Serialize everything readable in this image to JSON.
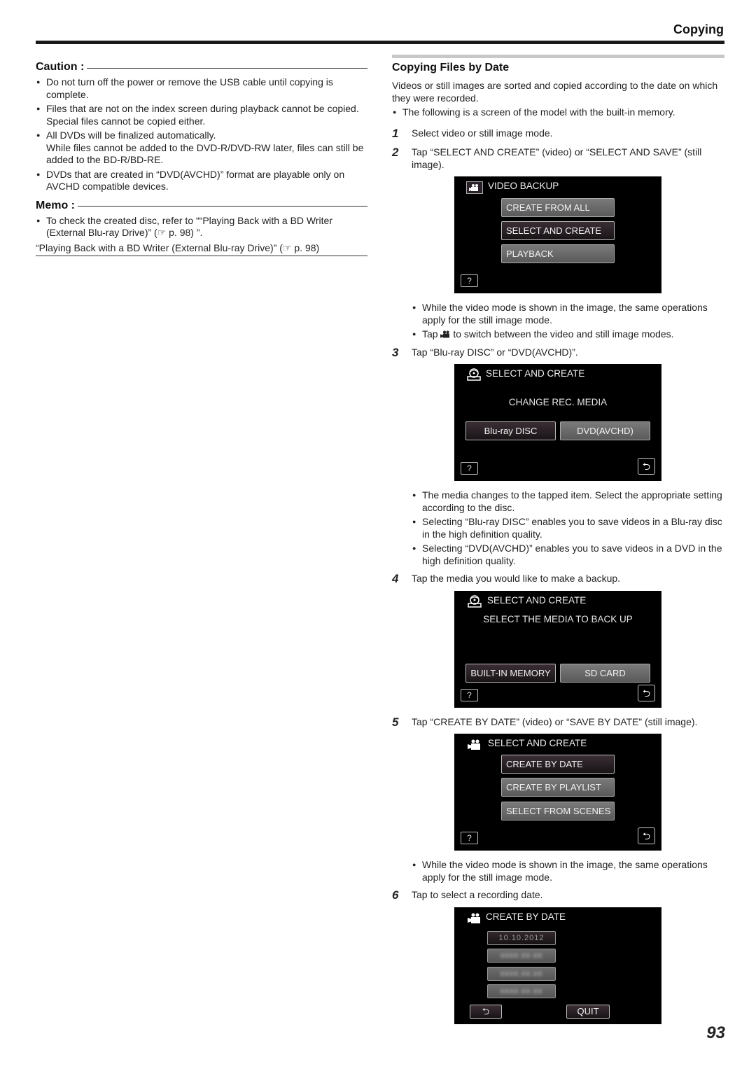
{
  "header": {
    "title": "Copying"
  },
  "caution": {
    "heading": "Caution :",
    "items": [
      "Do not turn off the power or remove the USB cable until copying is complete.",
      "Files that are not on the index screen during playback cannot be copied. Special files cannot be copied either.",
      "All DVDs will be finalized automatically.",
      "DVDs that are created in “DVD(AVCHD)” format are playable only on AVCHD compatible devices."
    ],
    "item3_extra": "While files cannot be added to the DVD-R/DVD-RW later, files can still be added to the BD-R/BD-RE."
  },
  "memo": {
    "heading": "Memo :",
    "items": [
      "To check the created disc, refer to ““Playing Back with a BD Writer (External Blu-ray Drive)” (☞ p. 98) ”."
    ],
    "link": "“Playing Back with a BD Writer (External Blu-ray Drive)” (☞ p. 98)"
  },
  "main": {
    "title": "Copying Files by Date",
    "intro": "Videos or still images are sorted and copied according to the date on which they were recorded.",
    "intro_bullet": "The following is a screen of the model with the built-in memory.",
    "steps": [
      {
        "num": "1",
        "text": "Select video or still image mode."
      },
      {
        "num": "2",
        "text": "Tap “SELECT AND CREATE” (video) or “SELECT AND SAVE” (still image).",
        "notes": [
          "While the video mode is shown in the image, the same operations apply for the still image mode.",
          "to switch between the video and still image modes."
        ],
        "note_tap": "Tap"
      },
      {
        "num": "3",
        "text": "Tap “Blu-ray DISC” or “DVD(AVCHD)”.",
        "notes": [
          "The media changes to the tapped item. Select the appropriate setting according to the disc.",
          "Selecting “Blu-ray DISC” enables you to save videos in a Blu-ray disc in the high definition quality.",
          "Selecting “DVD(AVCHD)” enables you to save videos in a DVD in the high definition quality."
        ]
      },
      {
        "num": "4",
        "text": "Tap the media you would like to make a backup."
      },
      {
        "num": "5",
        "text": "Tap “CREATE BY DATE” (video) or “SAVE BY DATE” (still image).",
        "notes": [
          "While the video mode is shown in the image, the same operations apply for the still image mode."
        ]
      },
      {
        "num": "6",
        "text": "Tap to select a recording date."
      }
    ]
  },
  "screens": {
    "video_backup": {
      "title": "VIDEO BACKUP",
      "buttons": [
        "CREATE FROM ALL",
        "SELECT AND CREATE",
        "PLAYBACK"
      ],
      "help": "?"
    },
    "change_media": {
      "title": "SELECT AND CREATE",
      "label": "CHANGE REC. MEDIA",
      "buttons": [
        "Blu-ray DISC",
        "DVD(AVCHD)"
      ],
      "help": "?",
      "back": "⮌"
    },
    "select_media": {
      "title": "SELECT AND CREATE",
      "label": "SELECT THE MEDIA TO BACK UP",
      "buttons": [
        "BUILT-IN MEMORY",
        "SD CARD"
      ],
      "help": "?",
      "back": "⮌"
    },
    "select_create": {
      "title": "SELECT AND CREATE",
      "buttons": [
        "CREATE BY DATE",
        "CREATE BY PLAYLIST",
        "SELECT FROM SCENES"
      ],
      "help": "?",
      "back": "⮌"
    },
    "create_by_date": {
      "title": "CREATE BY DATE",
      "dates": [
        "10.10.2012",
        "xxxx.xx.xx",
        "xxxx.xx.xx",
        "xxxx.xx.xx"
      ],
      "back": "⮌",
      "quit": "QUIT"
    }
  },
  "page_number": "93"
}
